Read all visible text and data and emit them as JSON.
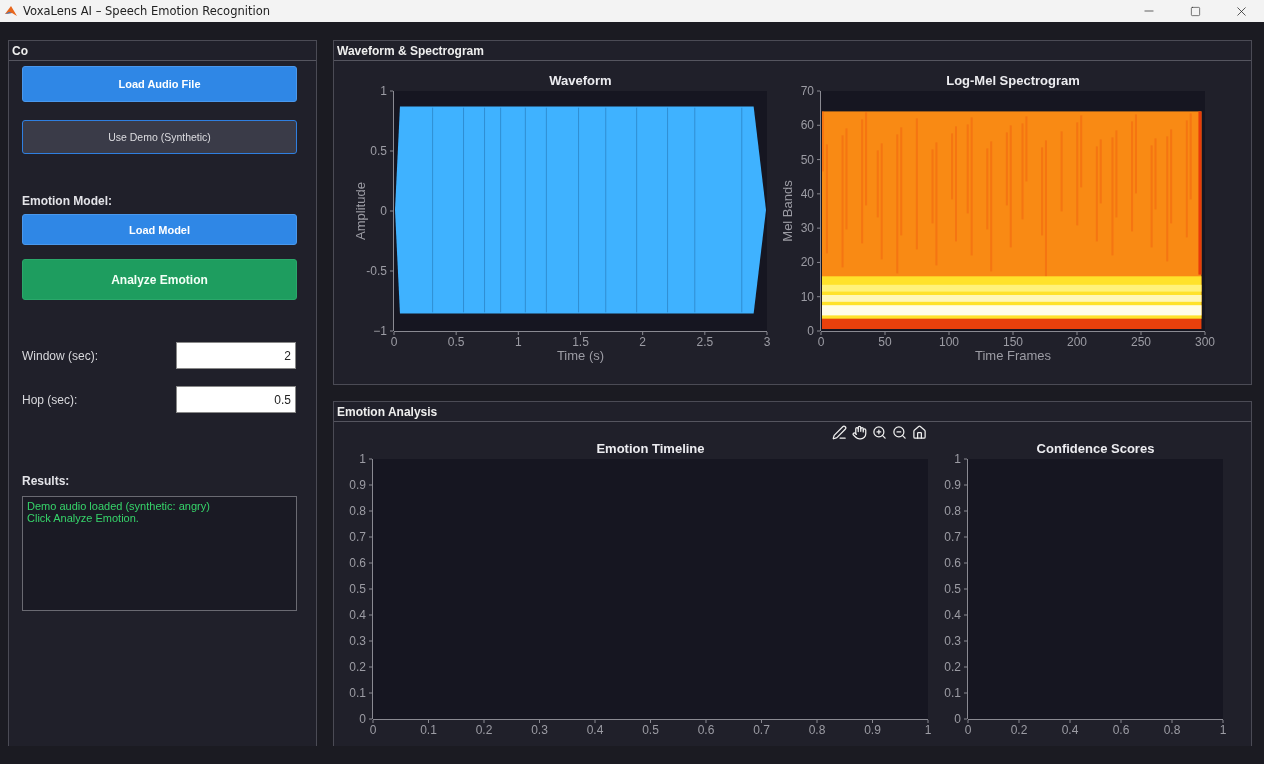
{
  "window": {
    "title": "VoxaLens AI – Speech Emotion Recognition"
  },
  "controls": {
    "title": "Co",
    "buttons": [
      {
        "label": "Load Audio File",
        "kind": "primary"
      },
      {
        "label": "Use Demo (Synthetic)",
        "kind": "secondary"
      }
    ],
    "model_label": "Emotion Model:",
    "model_buttons": [
      {
        "label": "Load Model",
        "kind": "primary"
      },
      {
        "label": "Analyze Emotion",
        "kind": "success"
      }
    ],
    "fields": [
      {
        "label": "Window (sec):",
        "value": "2"
      },
      {
        "label": "Hop (sec):",
        "value": "0.5"
      }
    ],
    "results": {
      "label": "Results:",
      "lines": [
        "Demo audio loaded (synthetic: angry)",
        "Click Analyze Emotion."
      ]
    }
  },
  "waveform_panel": {
    "title": "Waveform & Spectrogram",
    "plots": [
      {
        "kind": "waveform",
        "title": "Waveform",
        "xlabel": "Time (s)",
        "ylabel": "Amplitude",
        "xticks": [
          "0",
          "0.5",
          "1",
          "1.5",
          "2",
          "2.5",
          "3"
        ],
        "yticks": [
          "1",
          "0.5",
          "0",
          "-0.5",
          "−1"
        ]
      },
      {
        "kind": "spectrogram",
        "title": "Log-Mel Spectrogram",
        "xlabel": "Time Frames",
        "ylabel": "Mel Bands",
        "xticks": [
          "0",
          "50",
          "100",
          "150",
          "200",
          "250",
          "300"
        ],
        "yticks": [
          "70",
          "60",
          "50",
          "40",
          "30",
          "20",
          "10",
          "0"
        ]
      }
    ]
  },
  "analysis_panel": {
    "title": "Emotion Analysis",
    "plots": [
      {
        "kind": "timeline",
        "title": "Emotion Timeline",
        "xticks": [
          "0",
          "0.1",
          "0.2",
          "0.3",
          "0.4",
          "0.5",
          "0.6",
          "0.7",
          "0.8",
          "0.9",
          "1"
        ],
        "yticks": [
          "1",
          "0.9",
          "0.8",
          "0.7",
          "0.6",
          "0.5",
          "0.4",
          "0.3",
          "0.2",
          "0.1",
          "0"
        ]
      },
      {
        "kind": "scores",
        "title": "Confidence Scores",
        "xticks": [
          "0",
          "0.2",
          "0.4",
          "0.6",
          "0.8",
          "1"
        ],
        "yticks": [
          "1",
          "0.9",
          "0.8",
          "0.7",
          "0.6",
          "0.5",
          "0.4",
          "0.3",
          "0.2",
          "0.1",
          "0"
        ]
      }
    ]
  }
}
